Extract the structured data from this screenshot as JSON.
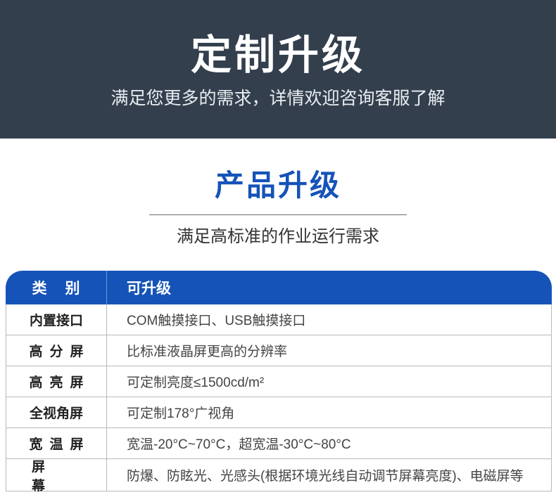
{
  "hero": {
    "title": "定制升级",
    "subtitle": "满足您更多的需求，详情欢迎咨询客服了解"
  },
  "section": {
    "title": "产品升级",
    "subtitle": "满足高标准的作业运行需求"
  },
  "table": {
    "headers": {
      "category": "类别",
      "upgrade": "可升级"
    },
    "rows": [
      {
        "key": "内置接口",
        "value": "COM触摸接口、USB触摸接口"
      },
      {
        "key": "高分屏",
        "value": "比标准液晶屏更高的分辨率"
      },
      {
        "key": "高亮屏",
        "value": "可定制亮度≤1500cd/m²"
      },
      {
        "key": "全视角屏",
        "value": "可定制178°广视角"
      },
      {
        "key": "宽温屏",
        "value": "宽温-20°C~70°C，超宽温-30°C~80°C"
      },
      {
        "key": "屏幕",
        "value": "防爆、防眩光、光感头(根据环境光线自动调节屏幕亮度)、电磁屏等"
      }
    ]
  },
  "colors": {
    "hero_bg": "#333f4d",
    "accent_blue": "#1553b8"
  }
}
